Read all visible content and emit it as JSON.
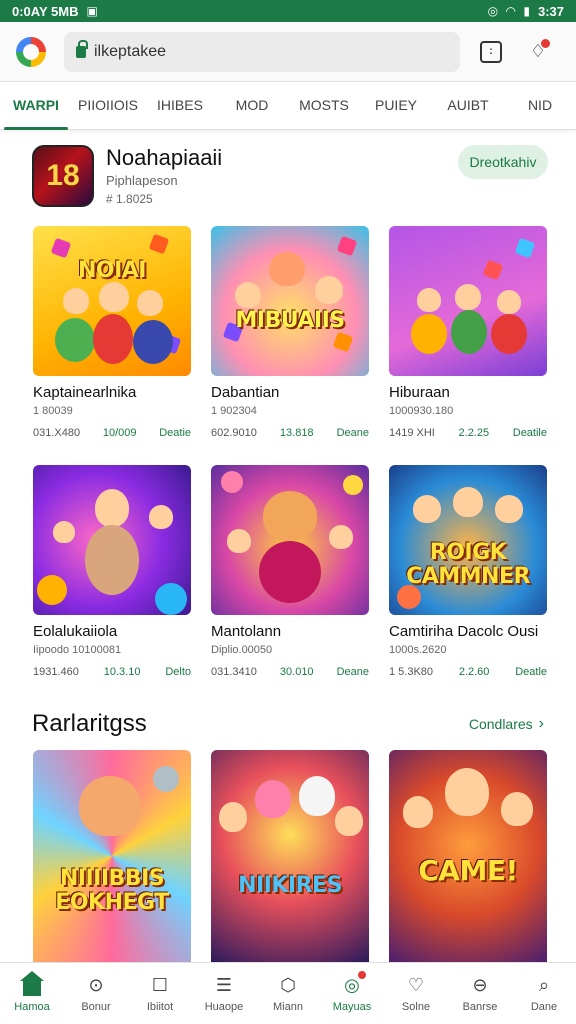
{
  "status_bar": {
    "time_left": "0:0AY 5MB",
    "time_right": "3:37"
  },
  "browser": {
    "url": "ilkeptakee",
    "tabs_count": ":"
  },
  "category_tabs": [
    {
      "label": "WARPI",
      "active": true
    },
    {
      "label": "PIIOIIOIS",
      "active": false
    },
    {
      "label": "IHIBES",
      "active": false
    },
    {
      "label": "MOD",
      "active": false
    },
    {
      "label": "MOSTS",
      "active": false
    },
    {
      "label": "PUIEY",
      "active": false
    },
    {
      "label": "AUIBT",
      "active": false
    },
    {
      "label": "NID",
      "active": false
    }
  ],
  "featured": {
    "icon_text": "18",
    "title": "Noahapiaaii",
    "subtitle": "Piphlapeson",
    "meta": "# 1.8025",
    "button_label": "Dreotkahiv"
  },
  "grid_cards": [
    {
      "logo": "NOIAI",
      "title": "Kaptainearlnika",
      "sub": "1 80039",
      "meta": [
        "031.X480",
        "10/009",
        "Deatie"
      ]
    },
    {
      "logo": "MIBUAIIS",
      "title": "Dabantian",
      "sub": "1 902304",
      "meta": [
        "602.9010",
        "13.818",
        "Deane"
      ]
    },
    {
      "logo": "",
      "title": "Hiburaan",
      "sub": "1000930.180",
      "meta": [
        "1419 XHI",
        "2.2.25",
        "Deatile"
      ]
    },
    {
      "logo": "",
      "title": "Eolalukaiiola",
      "sub": "Iipoodo 10100081",
      "meta": [
        "1931.460",
        "10.3.10",
        "Delto"
      ]
    },
    {
      "logo": "",
      "title": "Mantolann",
      "sub": "Diplio.00050",
      "meta": [
        "031.3410",
        "30.010",
        "Deane"
      ]
    },
    {
      "logo": "ROIGK CAMMNER",
      "title": "Camtiriha Dacolc Ousi",
      "sub": "1000s.2620",
      "meta": [
        "1 5.3K80",
        "2.2.60",
        "Deatle"
      ]
    }
  ],
  "section": {
    "title": "Rarlaritgss",
    "link": "Condlares"
  },
  "bottom_cards": [
    {
      "logo": "NIIIIBBIS EOKHEGT"
    },
    {
      "logo": "NIIKIRES"
    },
    {
      "logo": "CAME!"
    }
  ],
  "bottom_nav": [
    {
      "label": "Hamoa",
      "icon": "home-icon",
      "active": true
    },
    {
      "label": "Bonur",
      "icon": "search-icon",
      "active": false
    },
    {
      "label": "Ibiitot",
      "icon": "chat-icon",
      "active": false
    },
    {
      "label": "Huaope",
      "icon": "list-icon",
      "active": false
    },
    {
      "label": "Miann",
      "icon": "hexagon-icon",
      "active": false
    },
    {
      "label": "Mayuas",
      "icon": "compass-icon",
      "active": true
    },
    {
      "label": "Solne",
      "icon": "pin-icon",
      "active": false
    },
    {
      "label": "Banrse",
      "icon": "bookmark-icon",
      "active": false
    },
    {
      "label": "Dane",
      "icon": "magnifier-icon",
      "active": false
    }
  ],
  "colors": {
    "accent": "#1b7a45",
    "status_bar": "#1b7a45",
    "badge": "#e53935"
  }
}
